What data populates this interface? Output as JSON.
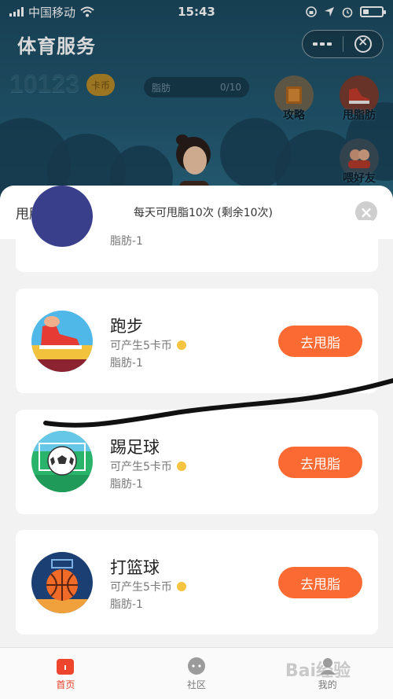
{
  "status_bar": {
    "carrier": "中国移动",
    "time": "15:43",
    "icons": [
      "signal-icon",
      "wifi-icon",
      "lock-rotation-icon",
      "location-icon",
      "alarm-icon",
      "battery-icon"
    ]
  },
  "header": {
    "title": "体育服务",
    "more_icon": "more-dots-icon",
    "close_icon": "close-circle-icon"
  },
  "scene": {
    "coin_count": "10123",
    "coin_badge": "卡币",
    "fat_label": "脂肪",
    "fat_progress": "0/10",
    "buttons": [
      {
        "label": "攻略",
        "icon": "book-icon"
      },
      {
        "label": "甩脂肪",
        "icon": "shoe-icon"
      },
      {
        "label": "喂好友",
        "icon": "friends-icon"
      }
    ]
  },
  "sheet": {
    "title": "甩脂肪",
    "subtitle": "每天可甩脂10次 (剩余10次)",
    "partial_card_text": "脂肪-1",
    "cards": [
      {
        "name": "跑步",
        "reward": "可产生5卡币",
        "effect": "脂肪-1",
        "button": "去甩脂",
        "icon": "running-shoe-icon"
      },
      {
        "name": "踢足球",
        "reward": "可产生5卡币",
        "effect": "脂肪-1",
        "button": "去甩脂",
        "icon": "soccer-ball-icon"
      },
      {
        "name": "打篮球",
        "reward": "可产生5卡币",
        "effect": "脂肪-1",
        "button": "去甩脂",
        "icon": "basketball-icon"
      }
    ]
  },
  "tabbar": {
    "tabs": [
      {
        "label": "首页",
        "icon": "home-icon",
        "active": true
      },
      {
        "label": "社区",
        "icon": "chat-icon",
        "active": false
      },
      {
        "label": "我的",
        "icon": "profile-icon",
        "active": false
      }
    ]
  },
  "watermark": "Bai经验",
  "colors": {
    "accent": "#fb6a32",
    "active_tab": "#e6402a",
    "coin": "#f5c542",
    "background_scene": "#235a73"
  }
}
